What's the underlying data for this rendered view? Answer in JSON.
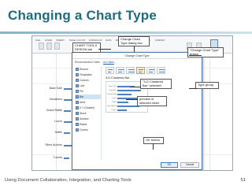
{
  "slide": {
    "title": "Changing a Chart Type",
    "footer": "Using Document Collaboration, Integration, and Charting Tools",
    "page_number": "51"
  },
  "ribbon": {
    "tabs": [
      "FILE",
      "HOME",
      "INSERT",
      "PAGE LAYOUT",
      "FORMULAS",
      "DATA",
      "REVIEW",
      "VIEW",
      "DESIGN",
      "FORMAT"
    ],
    "change_type_label": "Change Chart Type"
  },
  "background_chart": {
    "labels": [
      "Bake Sale",
      "Donations",
      "Grand Raffle",
      "Lunch",
      "Raffle",
      "Silent Auction",
      "T-shirts"
    ]
  },
  "dialog": {
    "title": "Change Chart Type",
    "help": "?",
    "close": "✕",
    "tabs": [
      "Recommended Charts",
      "All Charts"
    ],
    "chart_types": [
      "Recent",
      "Templates",
      "Column",
      "Line",
      "Pie",
      "Bar",
      "Area",
      "X Y (Scatter)",
      "Stock",
      "Surface",
      "Radar",
      "Combo"
    ],
    "selected_type": "Bar",
    "subtype_name": "3-D Clustered Bar",
    "ok_label": "OK",
    "cancel_label": "Cancel"
  },
  "callouts": {
    "change_chart_dialog": "Change Chart Type dialog box",
    "chart_tools": "CHART TOOLS DESIGN tab",
    "change_chart_button": "\"Change Chart Type\" button",
    "clustered_bar": "\"3-D Clustered Bar\" selected",
    "type_group": "Type group",
    "preview": "preview of selected chart",
    "ok_button": "OK button"
  },
  "colors": {
    "title": "#1f6b7f",
    "accent": "#4f81bd",
    "dialog_border": "#4a78a8"
  }
}
